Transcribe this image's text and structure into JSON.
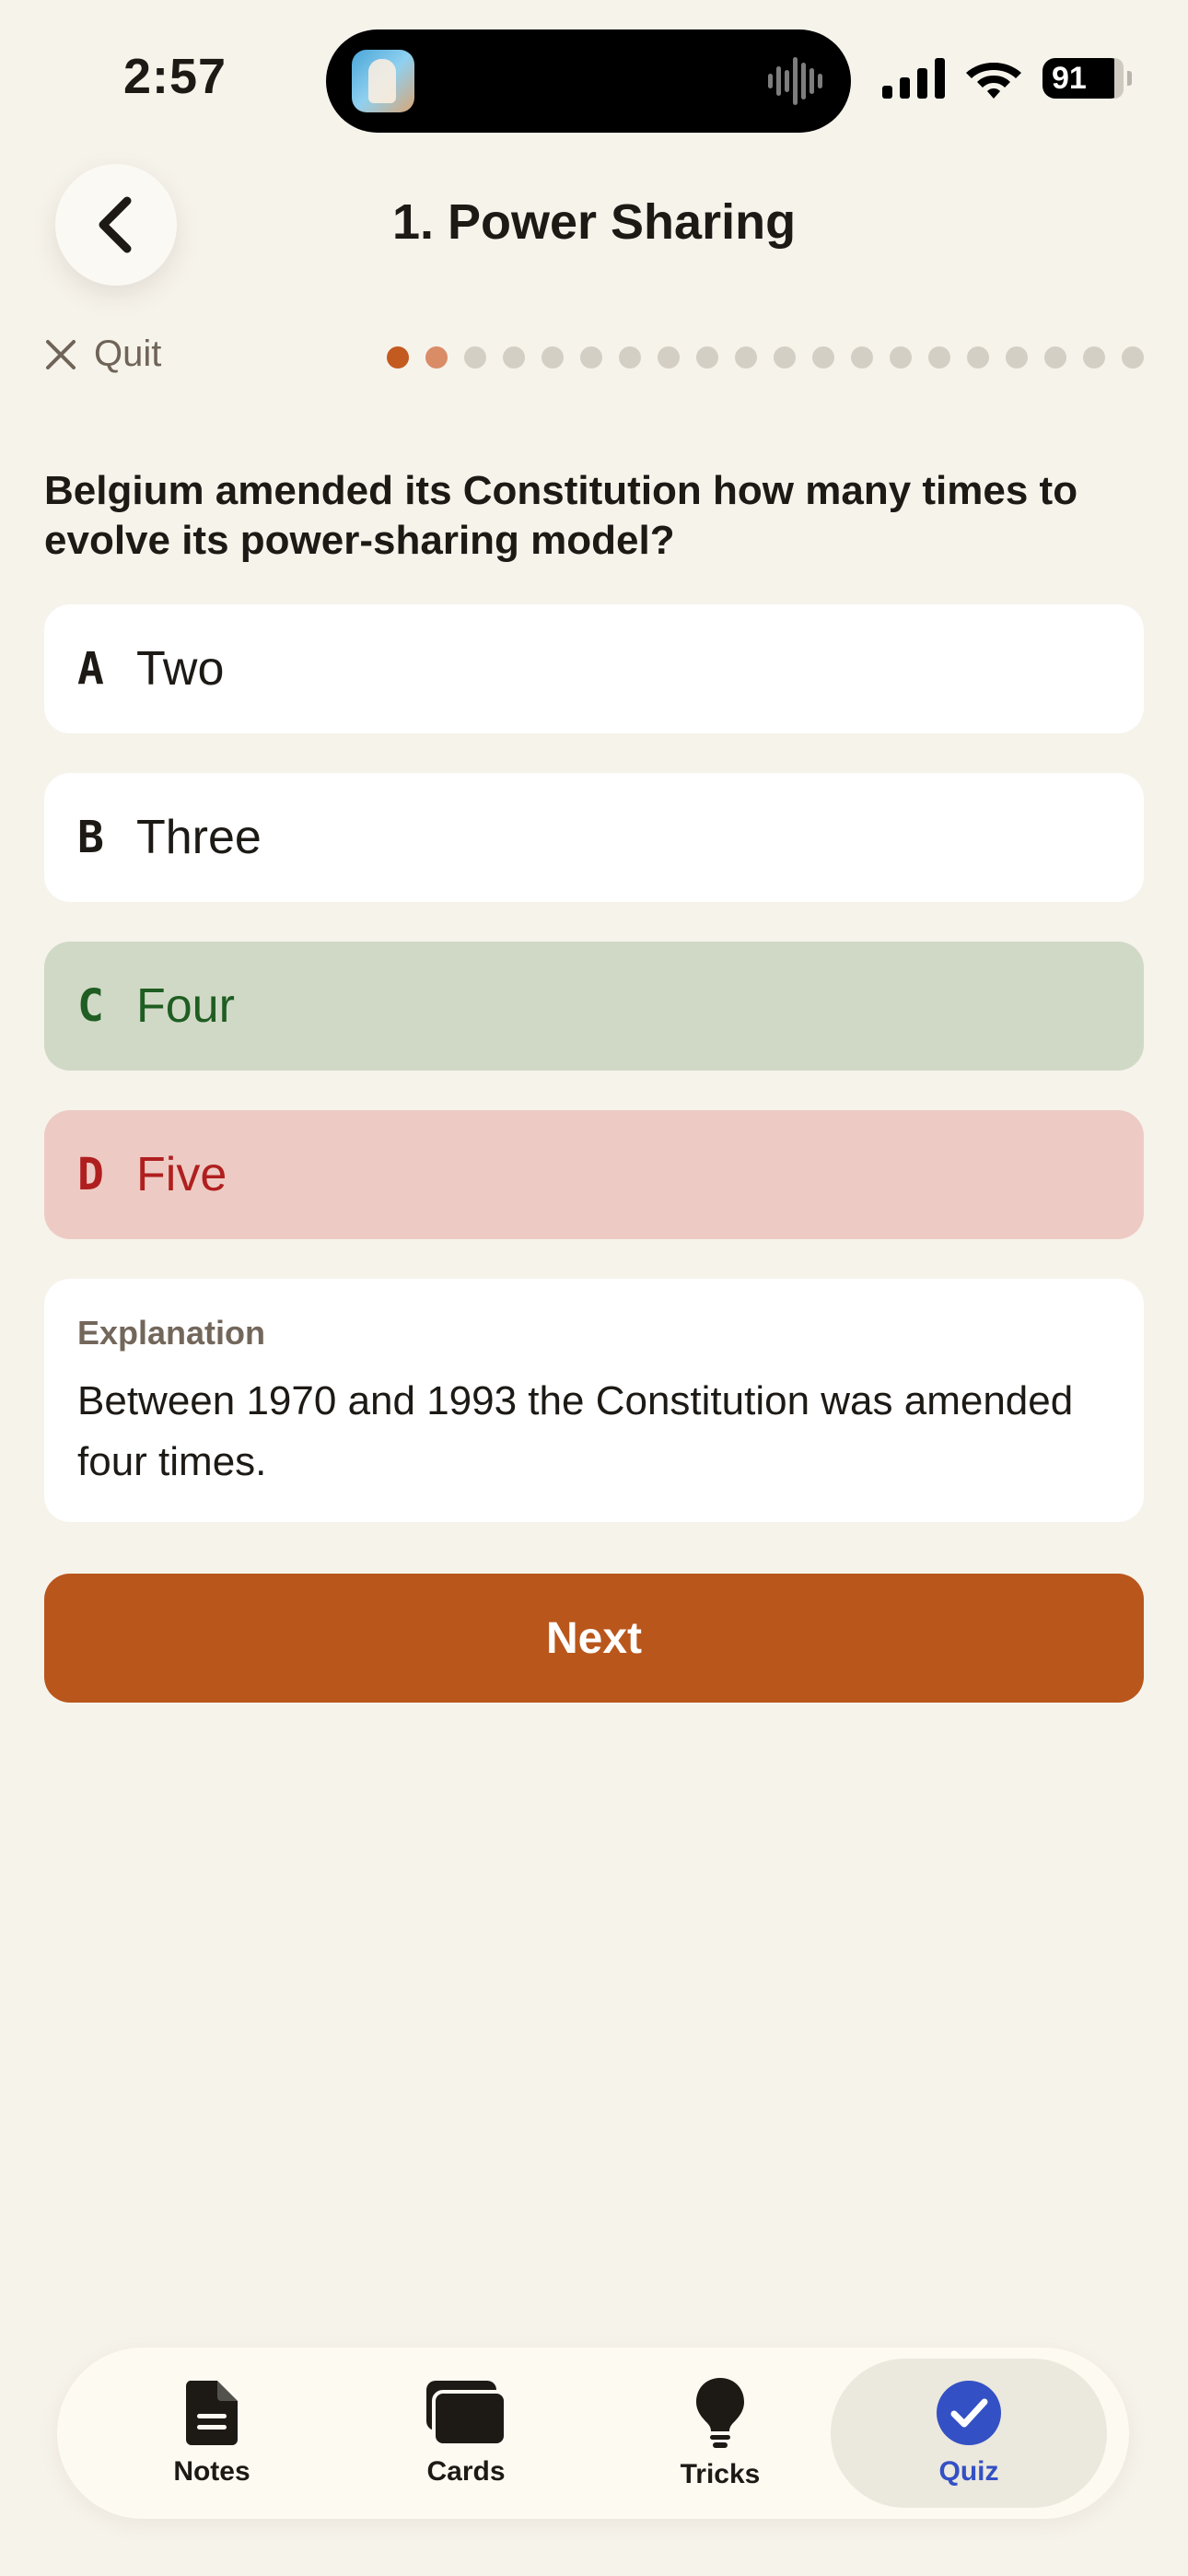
{
  "status_bar": {
    "time": "2:57",
    "battery": "91"
  },
  "header": {
    "title": "1. Power Sharing",
    "quit_label": "Quit"
  },
  "progress": {
    "total": 20,
    "current": 1,
    "answered": 1
  },
  "question": {
    "text": "Belgium amended its Constitution how many times to evolve its power-sharing model?"
  },
  "options": [
    {
      "letter": "A",
      "text": "Two",
      "state": "neutral"
    },
    {
      "letter": "B",
      "text": "Three",
      "state": "neutral"
    },
    {
      "letter": "C",
      "text": "Four",
      "state": "correct"
    },
    {
      "letter": "D",
      "text": "Five",
      "state": "wrong"
    }
  ],
  "explanation": {
    "title": "Explanation",
    "text": "Between 1970 and 1993 the Constitution was amended four times."
  },
  "next_label": "Next",
  "tabs": [
    {
      "label": "Notes",
      "icon": "document-icon"
    },
    {
      "label": "Cards",
      "icon": "cards-icon"
    },
    {
      "label": "Tricks",
      "icon": "lightbulb-icon"
    },
    {
      "label": "Quiz",
      "icon": "check-circle-icon",
      "active": true
    }
  ],
  "colors": {
    "accent": "#b9561b",
    "correct_bg": "#d0d9c6",
    "wrong_bg": "#edcbc4",
    "active_tab": "#3350c4"
  }
}
